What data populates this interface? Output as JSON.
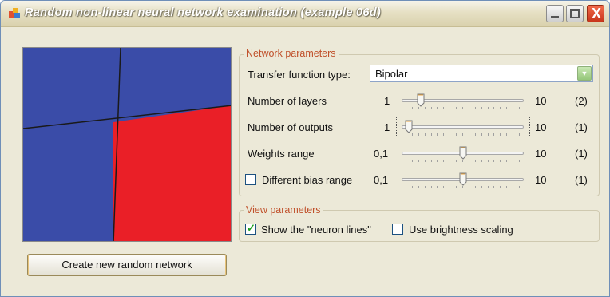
{
  "window": {
    "title": "Random non-linear neural network examination (example 06d)",
    "buttons": {
      "minimize": "minimize",
      "maximize": "maximize",
      "close": "close"
    },
    "close_glyph": "X"
  },
  "canvas": {
    "colors": {
      "blue": "#3a4ca8",
      "red": "#ea1f27",
      "line": "#1a1a1a"
    }
  },
  "create_button": {
    "label": "Create new random network"
  },
  "network_parameters": {
    "title": "Network parameters",
    "transfer_function": {
      "label": "Transfer function type:",
      "value": "Bipolar"
    },
    "sliders": [
      {
        "label": "Number of layers",
        "min": "1",
        "max": "10",
        "value": "(2)",
        "level": 0.11
      },
      {
        "label": "Number of outputs",
        "min": "1",
        "max": "10",
        "value": "(1)",
        "level": 0.0
      },
      {
        "label": "Weights range",
        "min": "0,1",
        "max": "10",
        "value": "(1)",
        "level": 0.5
      },
      {
        "label": "Different bias range",
        "min": "0,1",
        "max": "10",
        "value": "(1)",
        "level": 0.5,
        "checked": false
      }
    ]
  },
  "view_parameters": {
    "title": "View parameters",
    "show_neuron_lines": {
      "label": "Show the \"neuron lines\"",
      "checked": true
    },
    "brightness_scaling": {
      "label": "Use brightness scaling",
      "checked": false
    }
  },
  "colors": {
    "background": "#ece9d8",
    "group_title": "#c0502a",
    "check": "#21a121"
  }
}
